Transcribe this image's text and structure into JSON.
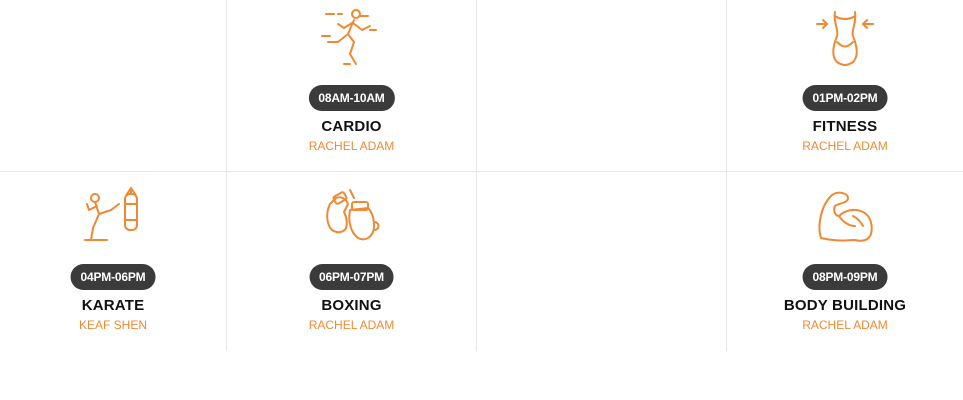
{
  "schedule": {
    "row1": {
      "col2": {
        "time": "08AM-10AM",
        "title": "CARDIO",
        "trainer": "RACHEL ADAM",
        "icon": "running-icon"
      },
      "col4": {
        "time": "01PM-02PM",
        "title": "FITNESS",
        "trainer": "RACHEL ADAM",
        "icon": "waist-icon"
      }
    },
    "row2": {
      "col1": {
        "time": "04PM-06PM",
        "title": "KARATE",
        "trainer": "KEAF SHEN",
        "icon": "kick-punching-bag-icon"
      },
      "col2": {
        "time": "06PM-07PM",
        "title": "BOXING",
        "trainer": "RACHEL ADAM",
        "icon": "boxing-gloves-icon"
      },
      "col4": {
        "time": "08PM-09PM",
        "title": "BODY BUILDING",
        "trainer": "RACHEL ADAM",
        "icon": "flexed-biceps-icon"
      }
    }
  },
  "colors": {
    "accent": "#ee8a34",
    "pill": "#3b3b3b",
    "title": "#111111",
    "divider": "#e6e6e6"
  }
}
